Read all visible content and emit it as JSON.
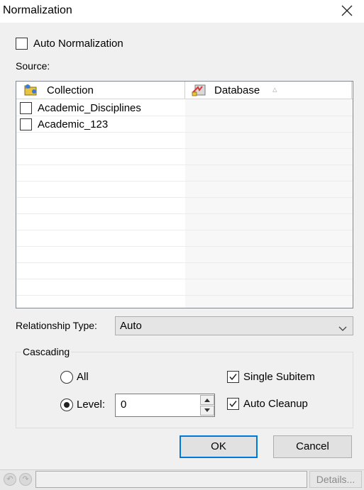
{
  "window": {
    "title": "Normalization",
    "close_icon": "✕"
  },
  "auto_normalization": {
    "label": "Auto Normalization",
    "checked": false
  },
  "source": {
    "label": "Source:",
    "columns": [
      "Collection",
      "Database"
    ],
    "sort_indicator": "▵",
    "rows": [
      {
        "collection": "Academic_Disciplines",
        "database": "",
        "checked": false
      },
      {
        "collection": "Academic_123",
        "database": "",
        "checked": false
      }
    ]
  },
  "relationship": {
    "label": "Relationship Type:",
    "value": "Auto",
    "dropdown_icon": "chevron-down-icon"
  },
  "cascading": {
    "legend": "Cascading",
    "all_label": "All",
    "level_label": "Level:",
    "level_value": "0",
    "selected": "level",
    "single_subitem_label": "Single Subitem",
    "single_subitem_checked": true,
    "auto_cleanup_label": "Auto Cleanup",
    "auto_cleanup_checked": true
  },
  "buttons": {
    "ok": "OK",
    "cancel": "Cancel"
  },
  "statusbar": {
    "details": "Details...",
    "status_text": ""
  }
}
